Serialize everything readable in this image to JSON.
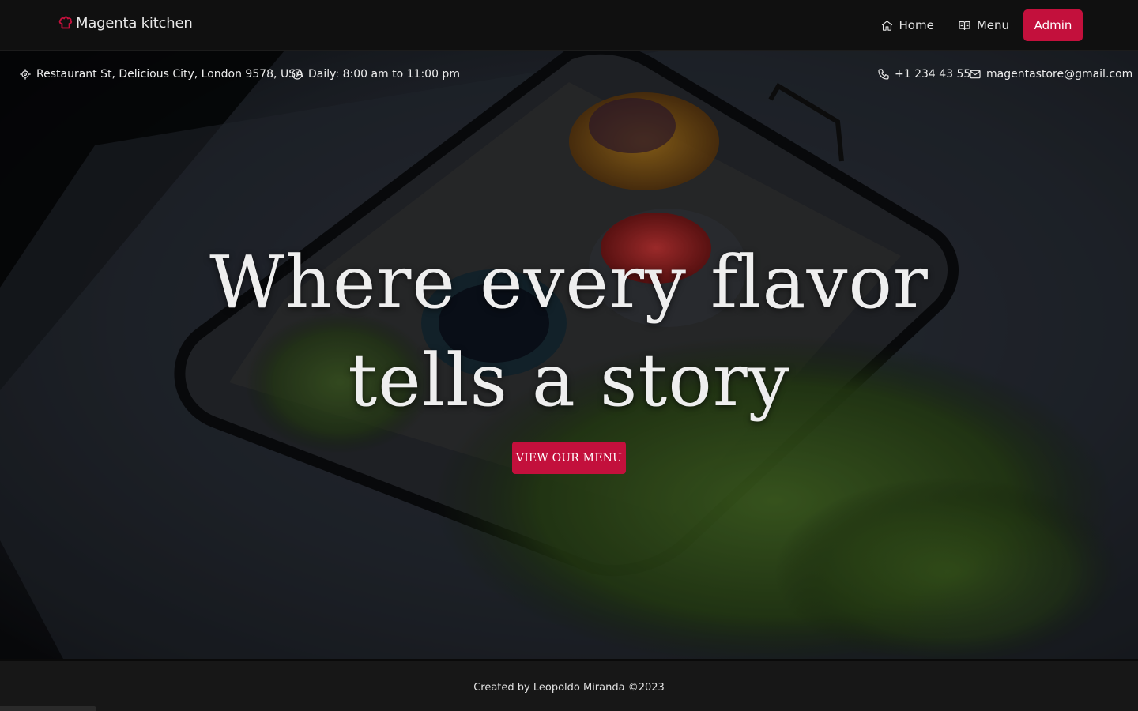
{
  "brand": {
    "name": "Magenta kitchen",
    "icon": "chef-hat-icon",
    "accent": "#c3103c"
  },
  "nav": {
    "home_label": "Home",
    "menu_label": "Menu",
    "admin_label": "Admin"
  },
  "topbar": {
    "address": "Restaurant St, Delicious City, London 9578, USA",
    "hours": "Daily: 8:00 am to 11:00 pm",
    "phone": "+1 234 43 55",
    "email": "magentastore@gmail.com"
  },
  "hero": {
    "headline_line1": "Where every flavor",
    "headline_line2": "tells a story",
    "cta_label": "VIEW OUR MENU"
  },
  "footer": {
    "credit": "Created by Leopoldo Miranda ©2023"
  }
}
